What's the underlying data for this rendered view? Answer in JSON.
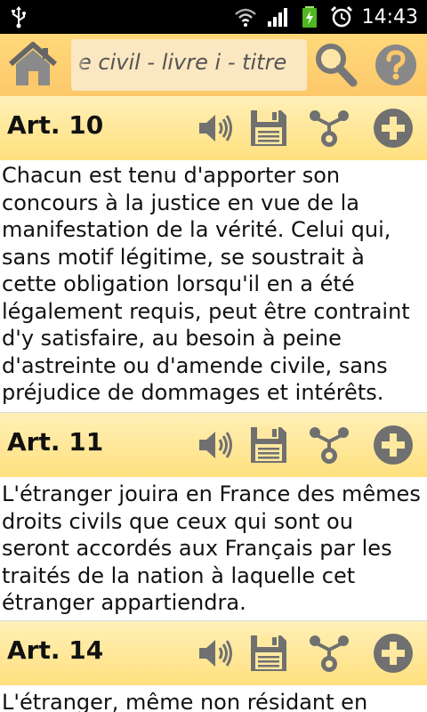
{
  "status_bar": {
    "time": "14:43",
    "icons": [
      "usb-icon",
      "wifi-icon",
      "signal-icon",
      "battery-charging-icon",
      "alarm-clock-icon"
    ]
  },
  "toolbar": {
    "title": "e civil - livre i - titre",
    "icons": [
      "home-icon",
      "search-icon",
      "help-icon"
    ]
  },
  "articles": [
    {
      "label": "Art. 10",
      "text": "Chacun est tenu d'apporter son concours à la justice en vue de la manifestation de la vérité. Celui qui, sans motif légitime, se soustrait à cette obligation lorsqu'il en a été légalement requis, peut être contraint d'y satisfaire, au besoin à peine d'astreinte ou d'amende civile, sans préjudice de dommages et intérêts."
    },
    {
      "label": "Art. 11",
      "text": "L'étranger jouira en France des mêmes droits civils que ceux qui sont ou seront accordés aux Français par les traités de la nation à laquelle cet étranger appartiendra."
    },
    {
      "label": "Art. 14",
      "text": "L'étranger, même non résidant en"
    }
  ],
  "article_action_icons": [
    "speaker-icon",
    "save-icon",
    "share-icon",
    "add-icon"
  ],
  "colors": {
    "toolbar_bg": "#fcc86a",
    "header_bg": "#ffe07e",
    "icon_gray": "#6b6b6b"
  }
}
